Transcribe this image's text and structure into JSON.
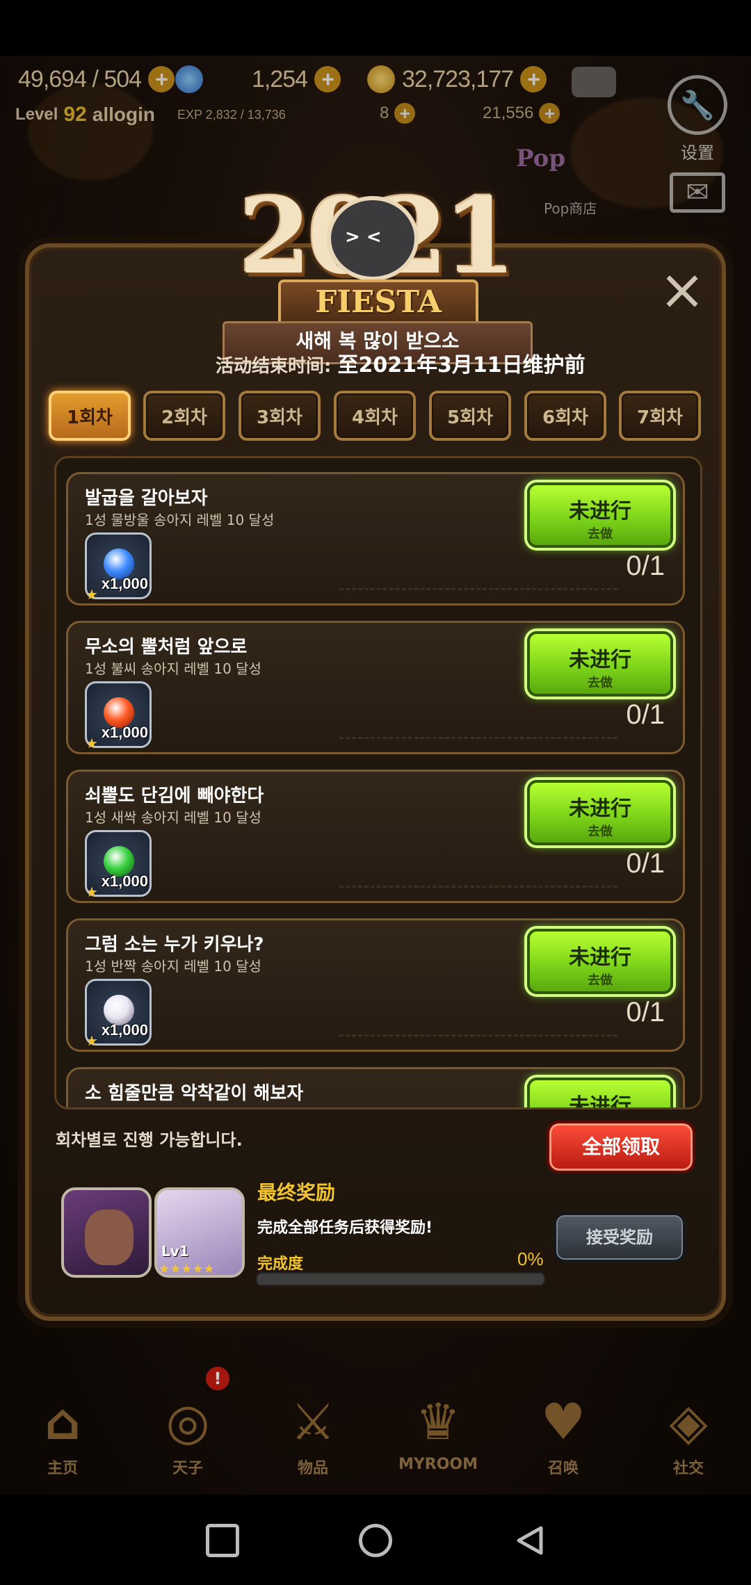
{
  "status": {
    "stamina": "49,694 / 504",
    "gems": "1,254",
    "gold": "32,723,177",
    "level_label": "Level",
    "level": "92",
    "username": "allogin",
    "exp": "EXP 2,832 / 13,736",
    "resource_a": "8",
    "resource_b": "21,556"
  },
  "side": {
    "settings_label": "设置",
    "popup_store_label": "Pop商店",
    "mail_label": "邮件"
  },
  "event": {
    "year": "2021",
    "logo_name": "FIESTA",
    "subtitle": "새해 복 많이 받으소",
    "deadline_label": "活动结束时间:",
    "deadline_value": "至2021年3月11日维护前"
  },
  "tabs": [
    {
      "label": "1회차"
    },
    {
      "label": "2회차"
    },
    {
      "label": "3회차"
    },
    {
      "label": "4회차"
    },
    {
      "label": "5회차"
    },
    {
      "label": "6회차"
    },
    {
      "label": "7회차"
    }
  ],
  "active_tab": 0,
  "missions": [
    {
      "title": "발굽을 갈아보자",
      "desc": "1성 물방울 송아지 레벨 10 달성",
      "reward_qty": "x1,000",
      "progress": "0/1",
      "btn_main": "未进行",
      "btn_sub": "去做",
      "orb": "#3f8cff"
    },
    {
      "title": "무소의 뿔처럼 앞으로",
      "desc": "1성 불씨 송아지 레벨 10 달성",
      "reward_qty": "x1,000",
      "progress": "0/1",
      "btn_main": "未进行",
      "btn_sub": "去做",
      "orb": "#ff5a24"
    },
    {
      "title": "쇠뿔도 단김에 빼야한다",
      "desc": "1성 새싹 송아지 레벨 10 달성",
      "reward_qty": "x1,000",
      "progress": "0/1",
      "btn_main": "未进行",
      "btn_sub": "去做",
      "orb": "#39d23f"
    },
    {
      "title": "그럼 소는 누가 키우나?",
      "desc": "1성 반짝 송아지 레벨 10 달성",
      "reward_qty": "x1,000",
      "progress": "0/1",
      "btn_main": "未进行",
      "btn_sub": "去做",
      "orb": "#e9e6f2"
    },
    {
      "title": "소 힘줄만큼 악착같이 해보자",
      "desc": "",
      "reward_qty": "",
      "progress": "",
      "btn_main": "未进行",
      "btn_sub": "",
      "orb": "#999"
    }
  ],
  "footer": {
    "note": "회차별로 진행 가능합니다.",
    "claim_all": "全部领取",
    "final_reward_title": "最终奖励",
    "final_reward_desc": "完成全部任务后获得奖励!",
    "completion_label": "完成度",
    "completion_pct": "0%",
    "completion_value": 0,
    "receive_btn": "接受奖励",
    "hero_level": "Lv1",
    "hero_stars": "★★★★★"
  },
  "nav": [
    {
      "label": "主页",
      "icon": "home-icon"
    },
    {
      "label": "天子",
      "icon": "flame-icon"
    },
    {
      "label": "物品",
      "icon": "sword-shield-icon"
    },
    {
      "label": "MYROOM",
      "icon": "crown-icon"
    },
    {
      "label": "召唤",
      "icon": "potion-icon"
    },
    {
      "label": "社交",
      "icon": "shield-icon"
    }
  ],
  "alert_badge": "!",
  "colors": {
    "accent_green": "#7ed51a",
    "accent_red": "#d8281a",
    "gold_text": "#f2c52e"
  }
}
